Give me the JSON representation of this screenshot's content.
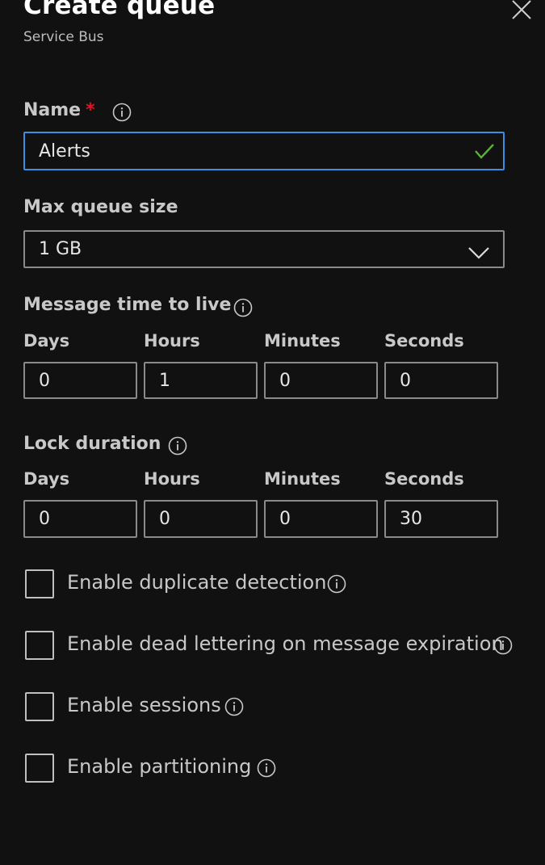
{
  "header": {
    "title": "Create queue",
    "subtitle": "Service Bus"
  },
  "name_field": {
    "label": "Name",
    "required_mark": "*",
    "value": "Alerts",
    "valid": true
  },
  "max_queue_size": {
    "label": "Max queue size",
    "selected": "1 GB"
  },
  "message_ttl": {
    "label": "Message time to live",
    "days_label": "Days",
    "hours_label": "Hours",
    "minutes_label": "Minutes",
    "seconds_label": "Seconds",
    "days": "0",
    "hours": "1",
    "minutes": "0",
    "seconds": "0"
  },
  "lock_duration": {
    "label": "Lock duration",
    "days_label": "Days",
    "hours_label": "Hours",
    "minutes_label": "Minutes",
    "seconds_label": "Seconds",
    "days": "0",
    "hours": "0",
    "minutes": "0",
    "seconds": "30"
  },
  "options": {
    "duplicate_detection": {
      "label": "Enable duplicate detection",
      "checked": false
    },
    "dead_lettering": {
      "label": "Enable dead lettering on message expiration",
      "checked": false
    },
    "sessions": {
      "label": "Enable sessions",
      "checked": false
    },
    "partitioning": {
      "label": "Enable partitioning",
      "checked": false
    }
  },
  "colors": {
    "background": "#111111",
    "focus_border": "#3a8fe0",
    "required": "#e81123",
    "valid_check": "#58b336"
  },
  "icons": {
    "close": "close-icon",
    "info": "info-icon",
    "valid": "checkmark-icon",
    "dropdown": "chevron-down-icon"
  }
}
